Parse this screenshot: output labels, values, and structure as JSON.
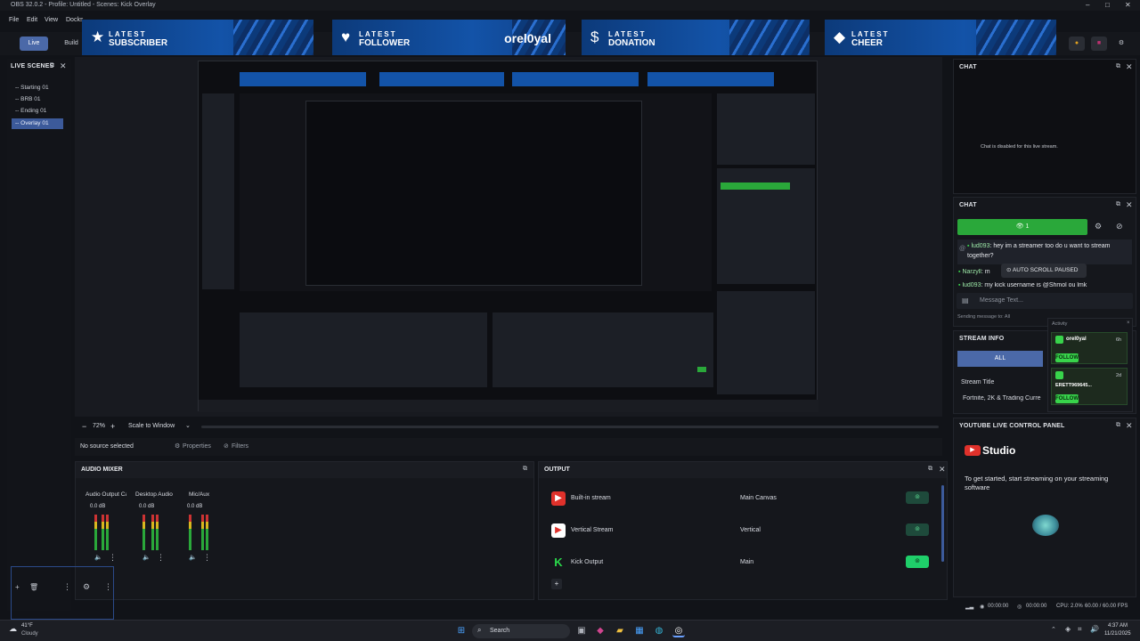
{
  "window": {
    "title": "OBS 32.0.2 - Profile: Untitled - Scenes: Kick Overlay",
    "controls": [
      "–",
      "□",
      "✕"
    ]
  },
  "menu": [
    "File",
    "Edit",
    "View",
    "Docks"
  ],
  "toolbar": {
    "live": "Live",
    "build": "Build"
  },
  "alerts": [
    {
      "top": "LATEST",
      "bottom": "SUBSCRIBER",
      "icon": "star-icon",
      "glyph": "★",
      "name": ""
    },
    {
      "top": "LATEST",
      "bottom": "FOLLOWER",
      "icon": "heart-icon",
      "glyph": "♥",
      "name": "orel0yal"
    },
    {
      "top": "LATEST",
      "bottom": "DONATION",
      "icon": "dollar-icon",
      "glyph": "$",
      "name": ""
    },
    {
      "top": "LATEST",
      "bottom": "CHEER",
      "icon": "diamond-icon",
      "glyph": "◆",
      "name": ""
    }
  ],
  "scenes": {
    "title": "LIVE SCENES",
    "items": [
      "-- Starting 01",
      "-- BRB 01",
      "-- Ending 01",
      "-- Overlay 01"
    ],
    "selected": 3
  },
  "preview_controls": {
    "minus": "−",
    "zoom": "72%",
    "plus": "+",
    "scale": "Scale to Window"
  },
  "source_bar": {
    "no_source": "No source selected",
    "properties": "Properties",
    "filters": "Filters"
  },
  "mixer": {
    "title": "AUDIO MIXER",
    "channels": [
      {
        "name": "Audio Output Ca",
        "db": "0.0 dB"
      },
      {
        "name": "Desktop Audio",
        "db": "0.0 dB"
      },
      {
        "name": "Mic/Aux",
        "db": "0.0 dB"
      }
    ]
  },
  "output": {
    "title": "OUTPUT",
    "rows": [
      {
        "name": "Built-in stream",
        "target": "Main Canvas",
        "color": "#e0312b",
        "glyph": "▶",
        "active": false
      },
      {
        "name": "Vertical Stream",
        "target": "Vertical",
        "color": "#ffffff",
        "glyph": "▶",
        "active": false
      },
      {
        "name": "Kick Output",
        "target": "Main",
        "color": "#2ad94b",
        "glyph": "K",
        "active": true
      }
    ],
    "add": "+"
  },
  "chat1": {
    "title": "CHAT",
    "disabled": "Chat is disabled for this live stream."
  },
  "chat2": {
    "title": "CHAT",
    "viewers": "1",
    "messages": [
      {
        "user": "lud093",
        "text": ": hey im a streamer too do u want to stream together?"
      },
      {
        "user": "Narzyll",
        "text": ": m"
      },
      {
        "user": "lud093",
        "text": ": my kick username is @Shmol ou lmk"
      }
    ],
    "paused": "AUTO SCROLL PAUSED",
    "placeholder": "Message Text...",
    "sending": "Sending message to: All"
  },
  "activity": {
    "title": "Activity",
    "items": [
      {
        "name": "orel0yal",
        "time": "6h",
        "action": "FOLLOW"
      },
      {
        "name": "ERETT969645...",
        "time": "2d",
        "action": "FOLLOW"
      }
    ]
  },
  "stream_info": {
    "title": "STREAM INFO",
    "tab": "ALL",
    "label": "Stream Title",
    "value": "Fortnite, 2K & Trading Curre"
  },
  "youtube": {
    "title": "YOUTUBE LIVE CONTROL PANEL",
    "brand": "Studio",
    "text": "To get started, start streaming on your streaming software"
  },
  "status": {
    "live_time": "00:00:00",
    "rec_time": "00:00:00",
    "cpu": "CPU: 2.0%",
    "fps": "60.00 / 60.00 FPS"
  },
  "taskbar": {
    "weather_temp": "41°F",
    "weather": "Cloudy",
    "search": "Search",
    "time": "4:37 AM",
    "date": "11/21/2025"
  },
  "colors": {
    "accent": "#3c5a9a",
    "kick_green": "#2aa83a",
    "alert_blue": "#1353a8"
  }
}
